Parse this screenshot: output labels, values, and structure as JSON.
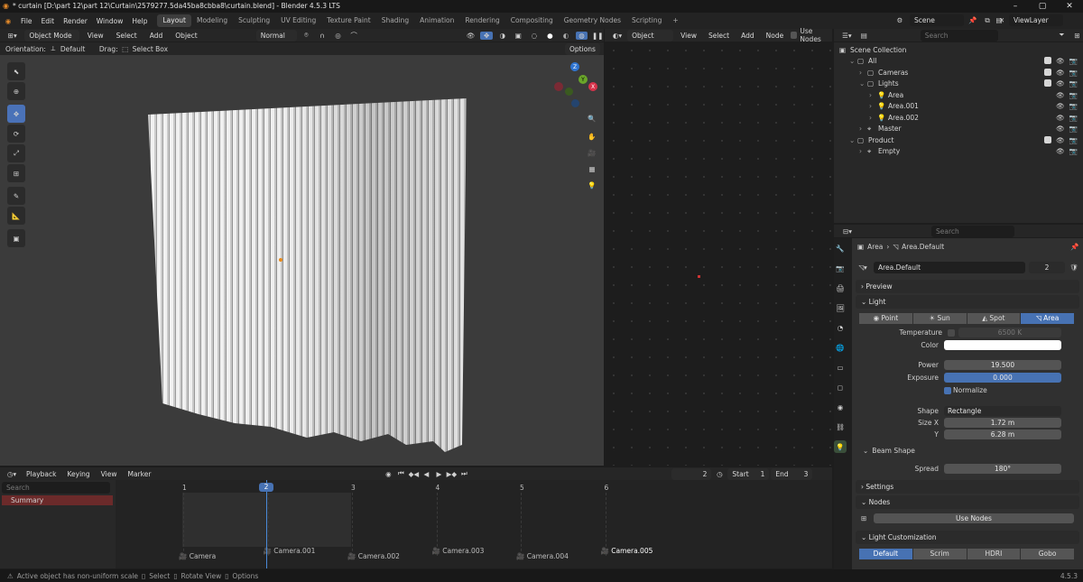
{
  "title": "* curtain [D:\\part 12\\part 12\\Curtain\\2579277.5da45ba8cbba8\\curtain.blend] - Blender 4.5.3 LTS",
  "menu": [
    "File",
    "Edit",
    "Render",
    "Window",
    "Help"
  ],
  "workspaces": [
    "Layout",
    "Modeling",
    "Sculpting",
    "UV Editing",
    "Texture Paint",
    "Shading",
    "Animation",
    "Rendering",
    "Compositing",
    "Geometry Nodes",
    "Scripting"
  ],
  "scene": "Scene",
  "view_layer": "ViewLayer",
  "viewport": {
    "mode": "Object Mode",
    "menus": [
      "View",
      "Select",
      "Add",
      "Object"
    ],
    "orientation_label": "Orientation:",
    "orientation": "Default",
    "drag_label": "Drag:",
    "drag": "Select Box",
    "pivot": "Normal",
    "options": "Options",
    "gizmo": {
      "z": "Z",
      "y": "Y",
      "x": "X"
    }
  },
  "node_editor": {
    "type": "Object",
    "menus": [
      "View",
      "Select",
      "Add",
      "Node"
    ],
    "use_nodes": "Use Nodes"
  },
  "outliner": {
    "search_placeholder": "Search",
    "items": [
      {
        "label": "Scene Collection",
        "indent": 0
      },
      {
        "label": "All",
        "indent": 1
      },
      {
        "label": "Cameras",
        "indent": 2
      },
      {
        "label": "Lights",
        "indent": 2
      },
      {
        "label": "Area",
        "indent": 3
      },
      {
        "label": "Area.001",
        "indent": 3
      },
      {
        "label": "Area.002",
        "indent": 3
      },
      {
        "label": "Master",
        "indent": 2
      },
      {
        "label": "Product",
        "indent": 1
      },
      {
        "label": "Empty",
        "indent": 2
      }
    ]
  },
  "properties": {
    "search_placeholder": "Search",
    "breadcrumb": [
      "Area",
      "Area.Default"
    ],
    "datablock": "Area.Default",
    "users": "2",
    "panels": {
      "preview": "Preview",
      "light": "Light",
      "settings": "Settings",
      "nodes": "Nodes",
      "customization": "Light Customization"
    },
    "light_types": [
      "Point",
      "Sun",
      "Spot",
      "Area"
    ],
    "active_light_type": "Area",
    "temperature_label": "Temperature",
    "temperature": "6500 K",
    "color_label": "Color",
    "color": "#ffffff",
    "power_label": "Power",
    "power": "19.500",
    "exposure_label": "Exposure",
    "exposure": "0.000",
    "normalize": "Normalize",
    "shape_label": "Shape",
    "shape": "Rectangle",
    "size_x_label": "Size X",
    "size_x": "1.72 m",
    "y_label": "Y",
    "size_y": "6.28 m",
    "beam_shape": "Beam Shape",
    "spread_label": "Spread",
    "spread": "180°",
    "use_nodes": "Use Nodes",
    "custom_tabs": [
      "Default",
      "Scrim",
      "HDRI",
      "Gobo"
    ]
  },
  "timeline": {
    "menus": [
      "Playback",
      "Keying",
      "View",
      "Marker"
    ],
    "current_frame": "2",
    "start_label": "Start",
    "start": "1",
    "end_label": "End",
    "end": "3",
    "search_placeholder": "Search",
    "summary": "Summary",
    "ticks": [
      "1",
      "2",
      "3",
      "4",
      "5",
      "6"
    ],
    "markers": [
      "Camera",
      "Camera.001",
      "Camera.002",
      "Camera.003",
      "Camera.004",
      "Camera.005"
    ]
  },
  "statusbar": {
    "message": "Active object has non-uniform scale",
    "hints": [
      "Select",
      "Rotate View",
      "Options"
    ],
    "version": "4.5.3"
  },
  "colors": {
    "accent": "#4772b3",
    "selected": "#e88a1a"
  }
}
